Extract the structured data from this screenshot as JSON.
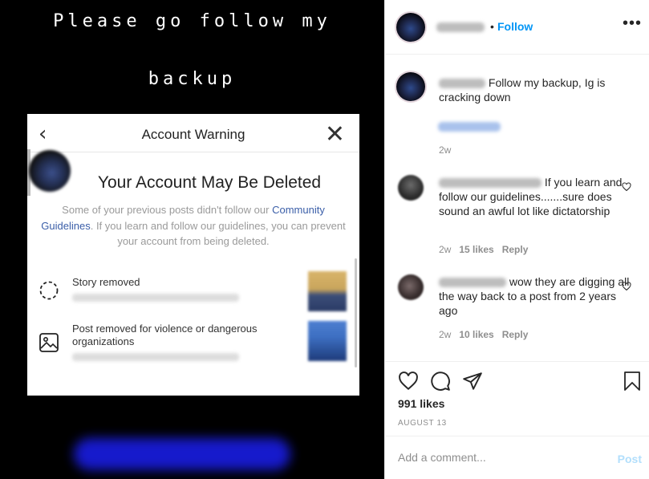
{
  "story": {
    "line1": "Please go follow my",
    "line2": "backup"
  },
  "warning": {
    "back_icon": "chevron-left-icon",
    "title": "Account Warning",
    "close_icon": "close-icon",
    "headline": "Your Account May Be Deleted",
    "body_pre": "Some of your previous posts didn't follow our ",
    "body_link1": "Community",
    "body_link2": "Guidelines",
    "body_post": ". If you learn and follow our guidelines, you can prevent your account from being deleted.",
    "items": [
      {
        "icon": "dashed-circle-icon",
        "label": "Story removed"
      },
      {
        "icon": "image-icon",
        "label": "Post removed for violence or dangerous organizations"
      }
    ]
  },
  "post": {
    "follow_label": "Follow",
    "separator": "•",
    "more_label": "•••",
    "caption": "Follow my backup, Ig is cracking down",
    "caption_time": "2w",
    "comments": [
      {
        "text": "If you learn and follow our guidelines.......sure does sound an awful lot like dictatorship",
        "time": "2w",
        "likes": "15 likes",
        "reply": "Reply"
      },
      {
        "text": "wow they are digging all the way back to a post from 2 years ago",
        "time": "2w",
        "likes": "10 likes",
        "reply": "Reply"
      }
    ],
    "likes": "991 likes",
    "date": "AUGUST 13",
    "comment_placeholder": "Add a comment...",
    "post_label": "Post"
  },
  "colors": {
    "accent": "#0095f6",
    "post_disabled": "#b2dffc",
    "story_bg": "#000000"
  }
}
